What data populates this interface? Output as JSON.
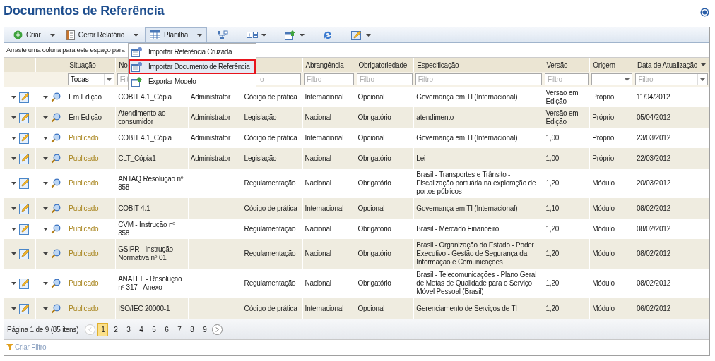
{
  "page": {
    "title": "Documentos de Referência"
  },
  "toolbar": [
    {
      "kind": "button",
      "label": "Criar",
      "has_menu": true,
      "selected": false
    },
    {
      "kind": "button",
      "label": "Gerar Relatório",
      "has_menu": true,
      "selected": false
    },
    {
      "kind": "button",
      "label": "Planilha",
      "has_menu": true,
      "selected": true
    },
    {
      "kind": "icon",
      "has_menu": false,
      "selected": false
    },
    {
      "kind": "icon",
      "has_menu": true,
      "selected": false
    },
    {
      "kind": "icon",
      "has_menu": true,
      "selected": false
    },
    {
      "kind": "icon",
      "has_menu": false,
      "selected": false
    },
    {
      "kind": "icon",
      "has_menu": true,
      "selected": false
    }
  ],
  "menu": {
    "items": [
      {
        "label": "Importar Referência Cruzada",
        "selected": false
      },
      {
        "label": "Importar Documento de Referência",
        "selected": true
      },
      {
        "label": "Exportar Modelo",
        "selected": false
      }
    ]
  },
  "group_hint": "Arraste uma coluna para este espaço para",
  "columns": [
    {},
    {},
    {
      "label": "Situação",
      "filter": {
        "kind": "select",
        "value": "Todas"
      }
    },
    {
      "label": "No",
      "filter": {
        "kind": "text",
        "placeholder": "Filt"
      }
    },
    {},
    {
      "filter": {
        "kind": "text",
        "placeholder": "o",
        "offset": true
      }
    },
    {
      "label": "Abrangência",
      "filter": {
        "kind": "text",
        "placeholder": "Filtro"
      }
    },
    {
      "label": "Obrigatoriedade",
      "filter": {
        "kind": "text",
        "placeholder": "Filtro"
      }
    },
    {
      "label": "Especificação",
      "filter": {
        "kind": "text",
        "placeholder": "Filtro"
      }
    },
    {
      "label": "Versão",
      "filter": {
        "kind": "text",
        "placeholder": "Filtro"
      }
    },
    {
      "label": "Origem",
      "filter": {
        "kind": "select"
      }
    },
    {
      "label": "Data de Atualização",
      "sort_menu": true,
      "filter": {
        "kind": "select",
        "placeholder": "Filtro"
      }
    }
  ],
  "rows": [
    {
      "status": {
        "text": "Em Edição",
        "color": "#222222"
      },
      "name": "COBIT 4.1_Cópia",
      "author": "Administrator",
      "type": "Código de prática",
      "scope": "Internacional",
      "obligation": "Opcional",
      "spec": "Governança em TI (Internacional)",
      "version": "Versão em Edição",
      "origin": "Próprio",
      "date": "11/04/2012"
    },
    {
      "status": {
        "text": "Em Edição",
        "color": "#222222"
      },
      "name": "Atendimento ao consumidor",
      "author": "Administrator",
      "type": "Legislação",
      "scope": "Nacional",
      "obligation": "Obrigatório",
      "spec": "atendimento",
      "version": "Versão em Edição",
      "origin": "Próprio",
      "date": "05/04/2012"
    },
    {
      "status": {
        "text": "Publicado",
        "color": "#a8841c"
      },
      "name": "COBIT 4.1_Cópia",
      "author": "Administrator",
      "type": "Código de prática",
      "scope": "Internacional",
      "obligation": "Opcional",
      "spec": "Governança em TI (Internacional)",
      "version": "1,00",
      "origin": "Próprio",
      "date": "23/03/2012"
    },
    {
      "status": {
        "text": "Publicado",
        "color": "#a8841c"
      },
      "name": "CLT_Cópia1",
      "author": "Administrator",
      "type": "Legislação",
      "scope": "Nacional",
      "obligation": "Obrigatório",
      "spec": "Lei",
      "version": "1,00",
      "origin": "Próprio",
      "date": "22/03/2012"
    },
    {
      "status": {
        "text": "Publicado",
        "color": "#a8841c"
      },
      "name": "ANTAQ Resolução nº 858",
      "type": "Regulamentação",
      "scope": "Nacional",
      "obligation": "Obrigatório",
      "spec": "Brasil - Transportes e Trânsito - Fiscalização portuária na exploração de portos públicos",
      "version": "1,20",
      "origin": "Módulo",
      "date": "20/03/2012"
    },
    {
      "status": {
        "text": "Publicado",
        "color": "#a8841c"
      },
      "name": "COBIT 4.1",
      "type": "Código de prática",
      "scope": "Internacional",
      "obligation": "Opcional",
      "spec": "Governança em TI (Internacional)",
      "version": "1,10",
      "origin": "Módulo",
      "date": "08/02/2012"
    },
    {
      "status": {
        "text": "Publicado",
        "color": "#a8841c"
      },
      "name": "CVM - Instrução nº 358",
      "type": "Regulamentação",
      "scope": "Nacional",
      "obligation": "Obrigatório",
      "spec": "Brasil - Mercado Financeiro",
      "version": "1,20",
      "origin": "Módulo",
      "date": "08/02/2012"
    },
    {
      "status": {
        "text": "Publicado",
        "color": "#a8841c"
      },
      "name": "GSIPR - Instrução Normativa nº 01",
      "type": "Regulamentação",
      "scope": "Nacional",
      "obligation": "Obrigatório",
      "spec": "Brasil - Organização do Estado - Poder Executivo - Gestão de Segurança da Informação e Comunicações",
      "version": "1,20",
      "origin": "Módulo",
      "date": "08/02/2012"
    },
    {
      "status": {
        "text": "Publicado",
        "color": "#a8841c"
      },
      "name": "ANATEL - Resolução nº 317 - Anexo",
      "type": "Regulamentação",
      "scope": "Nacional",
      "obligation": "Obrigatório",
      "spec": "Brasil - Telecomunicações - Plano Geral de Metas de Qualidade para o Serviço Móvel Pessoal (Brasil)",
      "version": "1,20",
      "origin": "Módulo",
      "date": "08/02/2012"
    },
    {
      "status": {
        "text": "Publicado",
        "color": "#a8841c"
      },
      "name": "ISO/IEC 20000-1",
      "type": "Código de prática",
      "scope": "Internacional",
      "obligation": "Opcional",
      "spec": "Gerenciamento de Serviços de TI",
      "version": "1,20",
      "origin": "Módulo",
      "date": "06/02/2012"
    }
  ],
  "pager": {
    "summary": "Página 1 de 9 (85 itens)",
    "pages": [
      {
        "label": "1",
        "selected": true
      },
      {
        "label": "2",
        "selected": false
      },
      {
        "label": "3",
        "selected": false
      },
      {
        "label": "4",
        "selected": false
      },
      {
        "label": "5",
        "selected": false
      },
      {
        "label": "6",
        "selected": false
      },
      {
        "label": "7",
        "selected": false
      },
      {
        "label": "8",
        "selected": false
      },
      {
        "label": "9",
        "selected": false
      }
    ]
  },
  "footer": {
    "filter_link": "Criar Filtro"
  }
}
